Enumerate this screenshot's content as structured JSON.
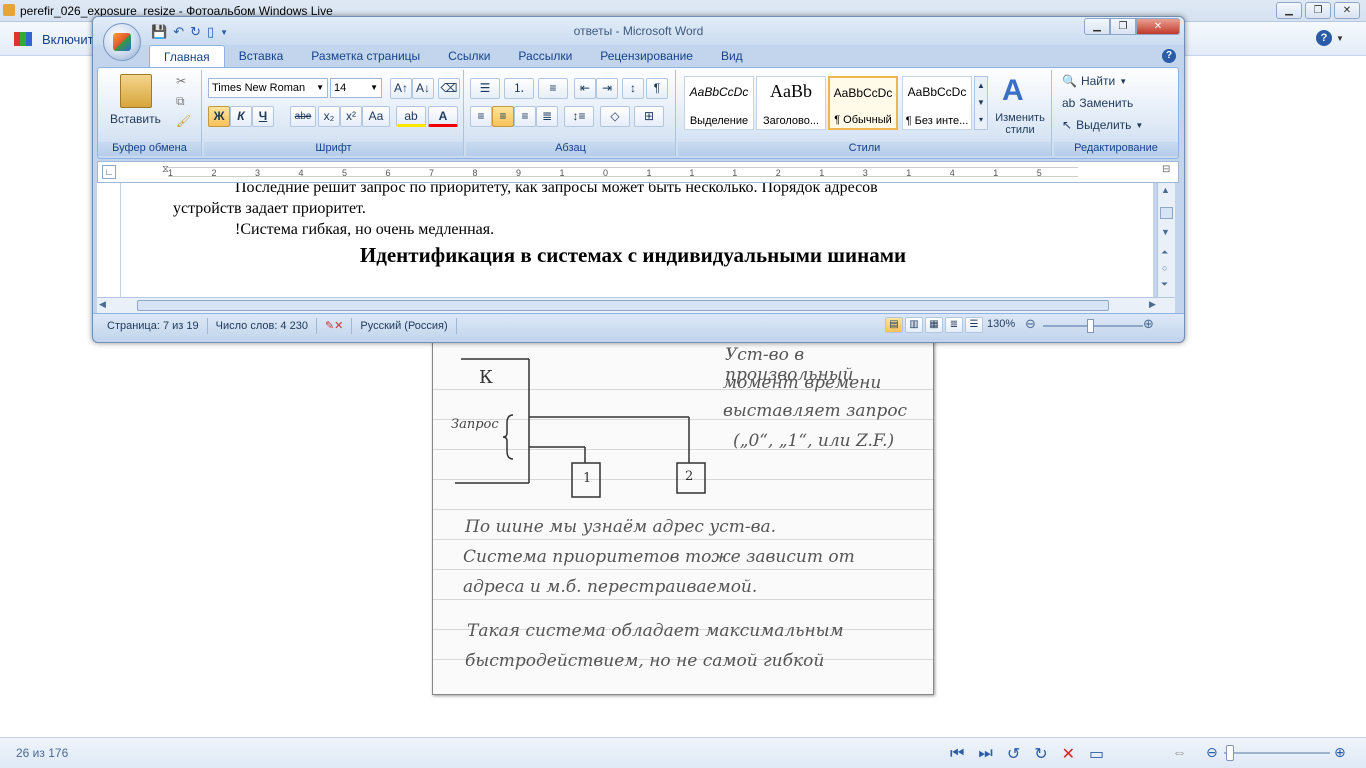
{
  "gallery": {
    "title": "perefir_026_exposure_resize - Фотоальбом Windows Live",
    "toolbar_item": "Включит",
    "counter": "26 из 176",
    "help": "?"
  },
  "photo": {
    "lines": [
      "Уст-во в произвольный",
      "момент времени",
      "выставляет запрос",
      "(„0“, „1“, или Z.F.)",
      "По шине мы узнаём адрес уст-ва.",
      "Система приоритетов тоже зависит от",
      "адреса и м.б. перестраиваемой.",
      "Такая система обладает максимальным",
      "быстродействием, но не самой гибкой"
    ],
    "diagram": {
      "k_label": "К",
      "request_label": "Запрос",
      "box1": "1",
      "box2": "2"
    }
  },
  "word": {
    "title": "ответы - Microsoft Word",
    "tabs": [
      "Главная",
      "Вставка",
      "Разметка страницы",
      "Ссылки",
      "Рассылки",
      "Рецензирование",
      "Вид"
    ],
    "clipboard": {
      "paste": "Вставить",
      "label": "Буфер обмена"
    },
    "font": {
      "name": "Times New Roman",
      "size": "14",
      "label": "Шрифт",
      "bold": "Ж",
      "italic": "К",
      "underline": "Ч",
      "strike": "abe",
      "sub": "x₂",
      "sup": "x²",
      "case": "Aa"
    },
    "paragraph": {
      "label": "Абзац"
    },
    "styles": {
      "label": "Стили",
      "items": [
        {
          "sample": "AaBbCcDc",
          "name": "Выделение"
        },
        {
          "sample": "AaBb",
          "name": "Заголово..."
        },
        {
          "sample": "AaBbCcDc",
          "name": "¶ Обычный"
        },
        {
          "sample": "AaBbCcDc",
          "name": "¶ Без инте..."
        }
      ],
      "change": "Изменить стили"
    },
    "editing": {
      "label": "Редактирование",
      "find": "Найти",
      "replace": "Заменить",
      "select": "Выделить"
    },
    "doc": {
      "line0": "Последние решит запрос по приоритету, как запросы может быть несколько. Порядок адресов",
      "line1": "устройств задает приоритет.",
      "line2": "!Система гибкая, но очень медленная.",
      "heading": "Идентификация в системах с индивидуальными шинами"
    },
    "status": {
      "page": "Страница: 7 из 19",
      "words": "Число слов: 4 230",
      "lang": "Русский (Россия)",
      "zoom": "130%"
    }
  }
}
